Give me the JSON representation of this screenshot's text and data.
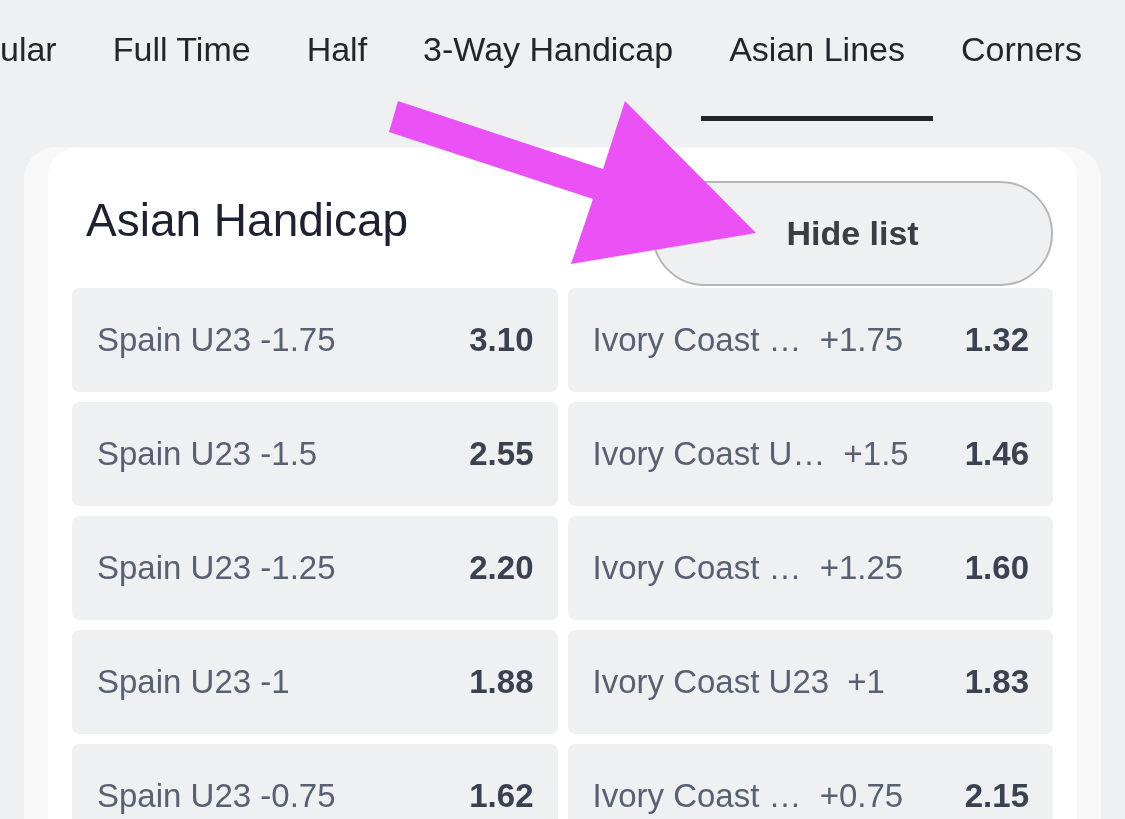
{
  "tabs": [
    {
      "label": "ular",
      "selected": false
    },
    {
      "label": "Full Time",
      "selected": false
    },
    {
      "label": "Half",
      "selected": false
    },
    {
      "label": "3-Way Handicap",
      "selected": false
    },
    {
      "label": "Asian Lines",
      "selected": true
    },
    {
      "label": "Corners",
      "selected": false
    }
  ],
  "market": {
    "title": "Asian Handicap",
    "toggle_button": "Hide list",
    "rows": [
      {
        "home": {
          "team": "Spain U23",
          "line": "-1.75",
          "odds": "3.10"
        },
        "away": {
          "team": "Ivory Coast …",
          "line": "+1.75",
          "odds": "1.32"
        }
      },
      {
        "home": {
          "team": "Spain U23",
          "line": "-1.5",
          "odds": "2.55"
        },
        "away": {
          "team": "Ivory Coast U…",
          "line": "+1.5",
          "odds": "1.46"
        }
      },
      {
        "home": {
          "team": "Spain U23",
          "line": "-1.25",
          "odds": "2.20"
        },
        "away": {
          "team": "Ivory Coast …",
          "line": "+1.25",
          "odds": "1.60"
        }
      },
      {
        "home": {
          "team": "Spain U23",
          "line": "-1",
          "odds": "1.88"
        },
        "away": {
          "team": "Ivory Coast U23",
          "line": "+1",
          "odds": "1.83"
        }
      },
      {
        "home": {
          "team": "Spain U23",
          "line": "-0.75",
          "odds": "1.62"
        },
        "away": {
          "team": "Ivory Coast …",
          "line": "+0.75",
          "odds": "2.15"
        }
      }
    ]
  }
}
